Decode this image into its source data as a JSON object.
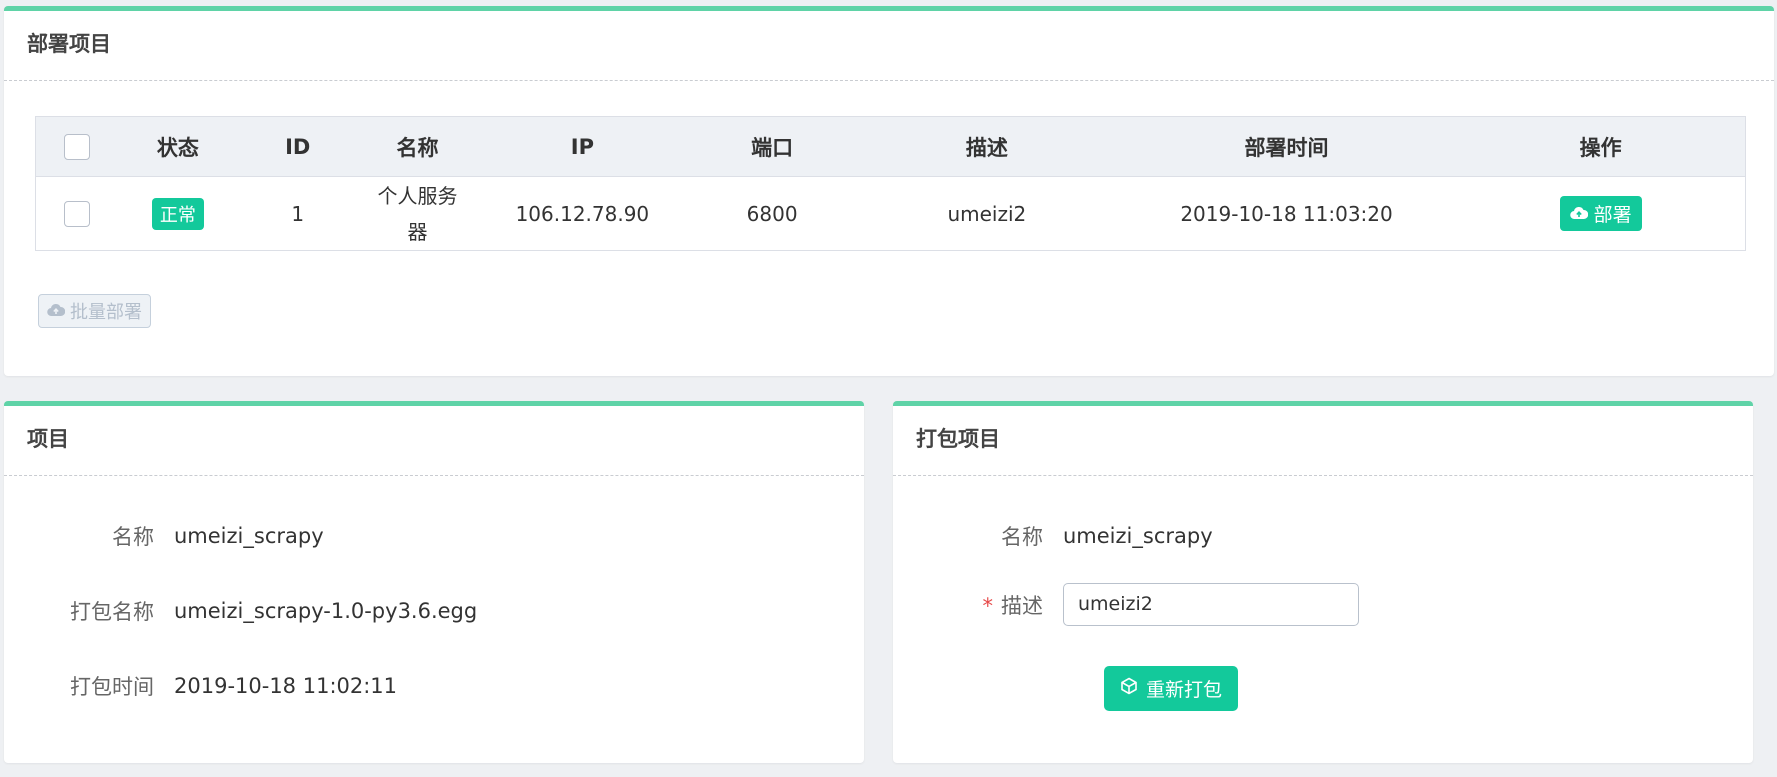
{
  "deploy_panel": {
    "title": "部署项目",
    "columns": [
      "状态",
      "ID",
      "名称",
      "IP",
      "端口",
      "描述",
      "部署时间",
      "操作"
    ],
    "rows": [
      {
        "status": "正常",
        "id": "1",
        "name_line1": "个人服务",
        "name_line2": "器",
        "ip": "106.12.78.90",
        "port": "6800",
        "description": "umeizi2",
        "deploy_time": "2019-10-18 11:03:20",
        "action": "部署"
      }
    ],
    "batch_button": "批量部署"
  },
  "project_panel": {
    "title": "项目",
    "name_label": "名称",
    "name_value": "umeizi_scrapy",
    "package_name_label": "打包名称",
    "package_name_value": "umeizi_scrapy-1.0-py3.6.egg",
    "package_time_label": "打包时间",
    "package_time_value": "2019-10-18 11:02:11"
  },
  "package_panel": {
    "title": "打包项目",
    "name_label": "名称",
    "name_value": "umeizi_scrapy",
    "required_mark": "*",
    "desc_label": "描述",
    "desc_value": "umeizi2",
    "repack_button": "重新打包"
  },
  "colors": {
    "accent": "#13c99b",
    "panel_top_border": "#5fd3a7"
  }
}
